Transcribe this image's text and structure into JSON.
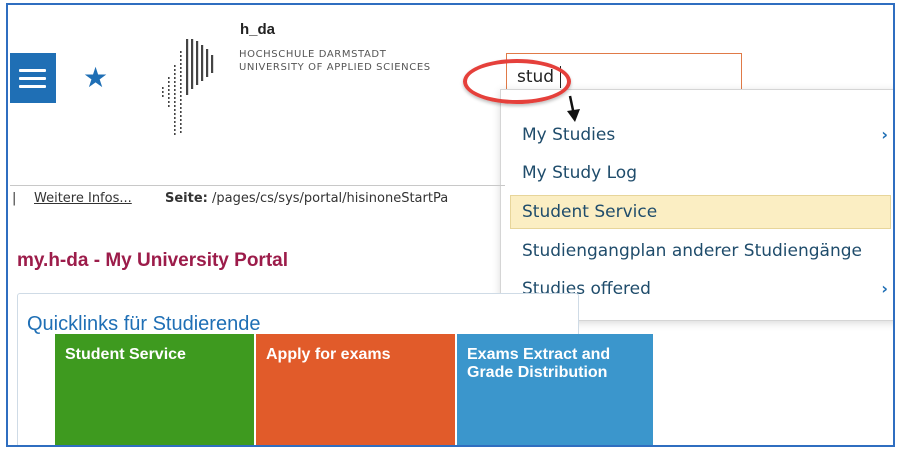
{
  "logo": {
    "name": "h_da",
    "line1": "HOCHSCHULE DARMSTADT",
    "line2": "UNIVERSITY OF APPLIED SCIENCES"
  },
  "search": {
    "value": "stud"
  },
  "dropdown": {
    "items": [
      {
        "label": "My Studies",
        "submenu": true,
        "highlighted": false
      },
      {
        "label": "My Study Log",
        "submenu": false,
        "highlighted": false
      },
      {
        "label": "Student Service",
        "submenu": false,
        "highlighted": true
      },
      {
        "label": "Studiengangplan anderer Studiengänge",
        "submenu": false,
        "highlighted": false
      },
      {
        "label": "Studies offered",
        "submenu": true,
        "highlighted": false
      }
    ],
    "chevron": "›"
  },
  "info_bar": {
    "pipe": "|",
    "more_link": "Weitere Infos...",
    "page_label": "Seite:",
    "page_path": "/pages/cs/sys/portal/hisinoneStartPa"
  },
  "page_title": "my.h-da - My University Portal",
  "quicklinks": {
    "title": "Quicklinks für Studierende",
    "tiles": [
      {
        "label": "Student Service",
        "color": "#3e9a1f"
      },
      {
        "label": "Apply for exams",
        "color": "#e15b2a"
      },
      {
        "label": "Exams Extract and Grade Distribution",
        "color": "#3b96cc"
      }
    ]
  },
  "colors": {
    "accent_blue": "#1f6fb5",
    "title_red": "#9c1c4a",
    "highlight": "#fbeec3",
    "annotation_red": "#e5403b"
  },
  "icons": {
    "menu": "hamburger-menu-icon",
    "favorite": "star-icon",
    "logo": "hda-logo-bars-icon",
    "annotation": "arrow-down-icon"
  }
}
